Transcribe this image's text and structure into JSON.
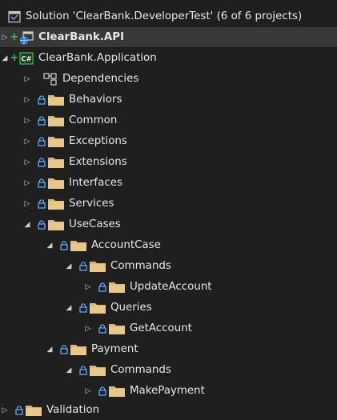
{
  "colors": {
    "background": "#1f1f1f",
    "selected_row": "#383838",
    "folder": "#dcb67a",
    "lock": "#58a6ff",
    "plus": "#3fb950",
    "solution_icon": "#9b6fdc",
    "csharp_icon": "#3fb950"
  },
  "tree": {
    "solution_label": "Solution 'ClearBank.DeveloperTest' (6 of 6 projects)",
    "api_project": "ClearBank.API",
    "application_project": "ClearBank.Application",
    "dependencies": "Dependencies",
    "behaviors": "Behaviors",
    "common": "Common",
    "exceptions": "Exceptions",
    "extensions": "Extensions",
    "interfaces": "Interfaces",
    "services": "Services",
    "usecases": "UseCases",
    "accountcase": "AccountCase",
    "accountcase_commands": "Commands",
    "update_account": "UpdateAccount",
    "queries": "Queries",
    "get_account": "GetAccount",
    "payment": "Payment",
    "payment_commands": "Commands",
    "make_payment": "MakePayment",
    "validation": "Validation"
  }
}
